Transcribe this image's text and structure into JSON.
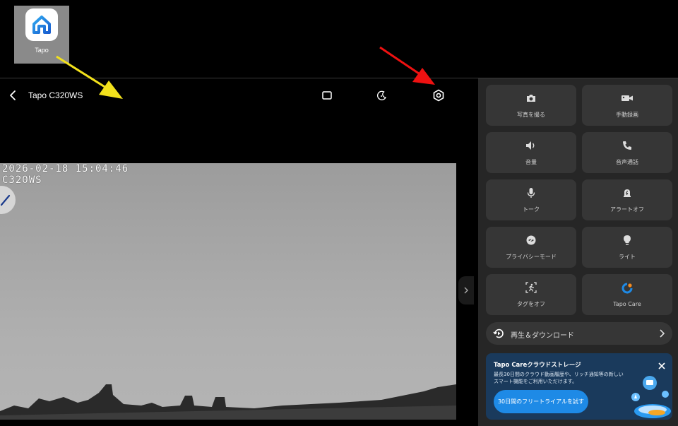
{
  "desktop": {
    "icon_label": "Tapo"
  },
  "header": {
    "title": "Tapo C320WS"
  },
  "video": {
    "timestamp": "2026-02-18 15:04:46",
    "camera_name": "C320WS"
  },
  "controls": [
    {
      "label": "写真を撮る",
      "icon": "camera-icon"
    },
    {
      "label": "手動録画",
      "icon": "video-record-icon"
    },
    {
      "label": "音量",
      "icon": "speaker-icon"
    },
    {
      "label": "音声通話",
      "icon": "phone-icon"
    },
    {
      "label": "トーク",
      "icon": "microphone-icon"
    },
    {
      "label": "アラートオフ",
      "icon": "alarm-off-icon"
    },
    {
      "label": "プライバシーモード",
      "icon": "privacy-icon"
    },
    {
      "label": "ライト",
      "icon": "bulb-icon"
    },
    {
      "label": "タグをオフ",
      "icon": "motion-tag-icon"
    },
    {
      "label": "Tapo Care",
      "icon": "tapo-care-icon"
    }
  ],
  "playback": {
    "label": "再生＆ダウンロード"
  },
  "promo": {
    "title": "Tapo Careクラウドストレージ",
    "description": "最長30日間のクラウド動画履歴や、リッチ通知等の新しいスマート機能をご利用いただけます。",
    "cta": "30日間のフリートライアルを試す"
  },
  "colors": {
    "accent": "#1e8ae6",
    "panel": "#262626",
    "tile": "#363636",
    "promo_bg": "#1a3a5c",
    "arrow_yellow": "#f2e11c",
    "arrow_red": "#ee1111"
  }
}
